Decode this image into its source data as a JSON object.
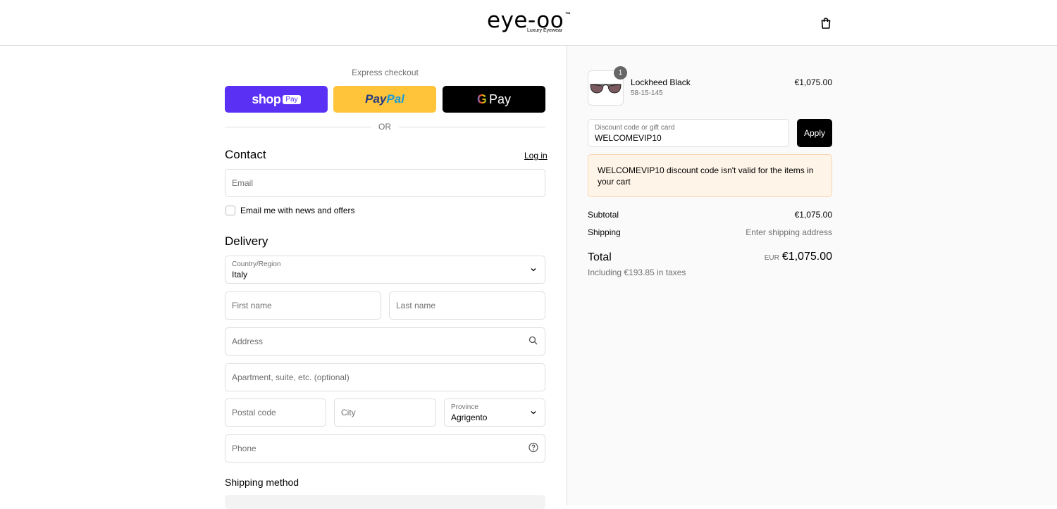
{
  "header": {
    "brand": "eye-oo",
    "trademark": "™",
    "tagline": "Luxury Eyewear",
    "cart_icon": "shopping-bag-icon"
  },
  "express": {
    "title": "Express checkout",
    "shop_pay": {
      "word": "shop",
      "box": "Pay",
      "color": "#5a31f4"
    },
    "paypal": {
      "part1": "Pay",
      "part2": "Pal",
      "color": "#ffc439"
    },
    "gpay": {
      "g": "G",
      "word": "Pay",
      "color": "#000000"
    },
    "or": "OR"
  },
  "contact": {
    "heading": "Contact",
    "login": "Log in",
    "email_placeholder": "Email",
    "newsletter_label": "Email me with news and offers",
    "newsletter_checked": false
  },
  "delivery": {
    "heading": "Delivery",
    "country_label": "Country/Region",
    "country_value": "Italy",
    "first_name_placeholder": "First name",
    "last_name_placeholder": "Last name",
    "address_placeholder": "Address",
    "apartment_placeholder": "Apartment, suite, etc. (optional)",
    "postal_placeholder": "Postal code",
    "city_placeholder": "City",
    "province_label": "Province",
    "province_value": "Agrigento",
    "phone_placeholder": "Phone"
  },
  "shipping_method": {
    "heading": "Shipping method"
  },
  "order": {
    "item": {
      "name": "Lockheed Black",
      "variant": "58-15-145",
      "price": "€1,075.00",
      "quantity": "1"
    },
    "discount": {
      "label": "Discount code or gift card",
      "value": "WELCOMEVIP10",
      "apply": "Apply",
      "error": "WELCOMEVIP10 discount code isn't valid for the items in your cart"
    },
    "subtotal_label": "Subtotal",
    "subtotal_value": "€1,075.00",
    "shipping_label": "Shipping",
    "shipping_value": "Enter shipping address",
    "total_label": "Total",
    "total_currency": "EUR",
    "total_value": "€1,075.00",
    "tax_note": "Including €193.85 in taxes"
  }
}
